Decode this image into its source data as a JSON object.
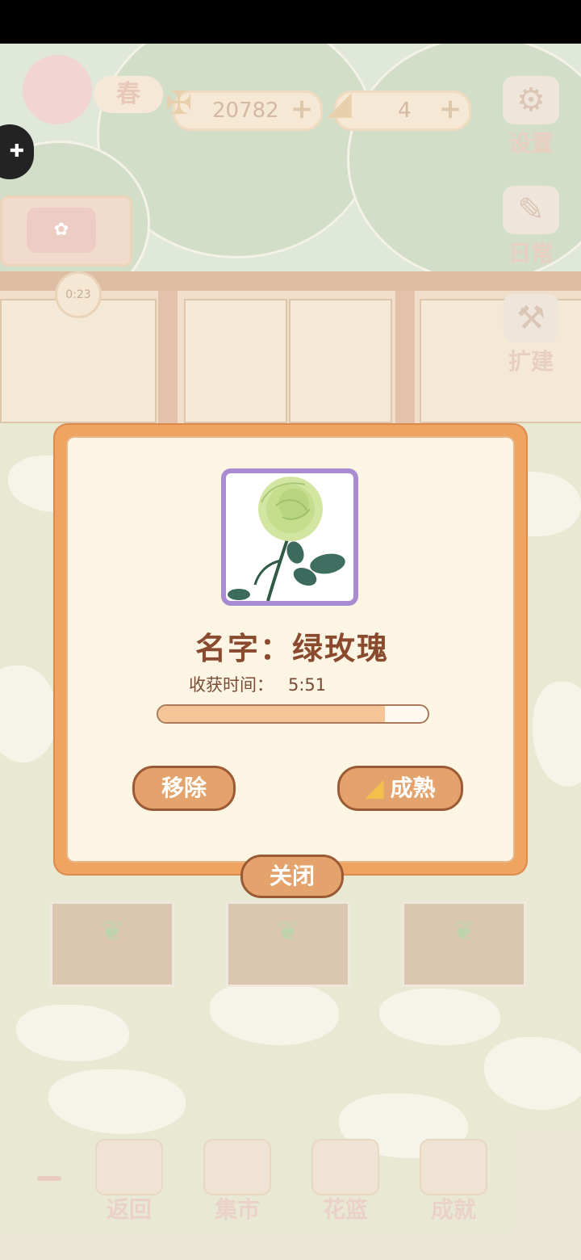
{
  "hud": {
    "season_label": "春",
    "fish_count": "20782",
    "cheese_count": "4",
    "plus": "+",
    "settings_label": "设置",
    "daily_label": "日常",
    "expand_label": "扩建",
    "alarm_time": "0:23"
  },
  "modal": {
    "name_line": "名字：绿玫瑰",
    "harvest_label": "收获时间：",
    "harvest_time": "5:51",
    "progress_fraction": 0.84,
    "remove_label": "移除",
    "ripen_label": "成熟",
    "close_label": "关闭"
  },
  "bottom_nav": {
    "back_label": "返回",
    "market_label": "集市",
    "basket_label": "花篮",
    "achievement_label": "成就"
  },
  "colors": {
    "modal_border": "#f0a462",
    "button_fill": "#e4a36c",
    "button_outline": "#9a5a36",
    "title_text": "#8a4a2e",
    "portrait_frame": "#a88bd0"
  }
}
